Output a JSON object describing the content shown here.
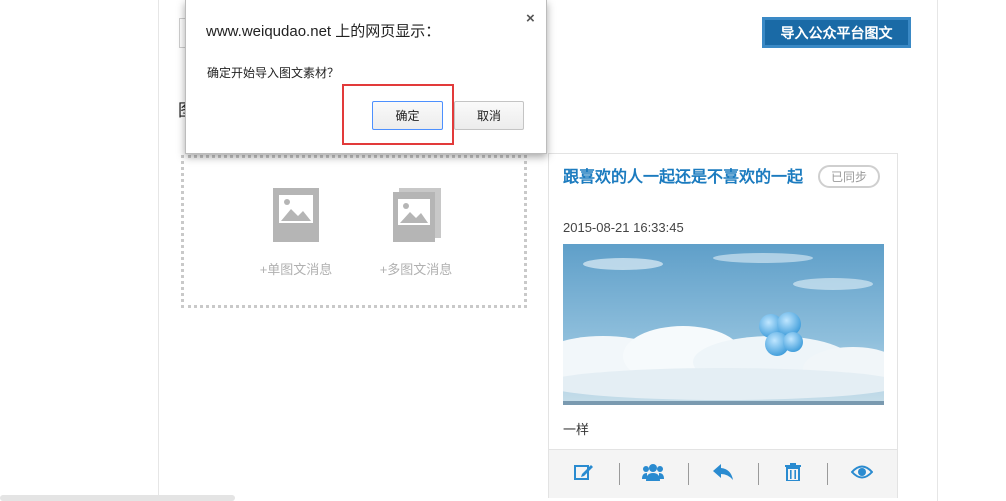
{
  "toolbar": {
    "import_label": "导入公众平台图文"
  },
  "section": {
    "heading_char": "图"
  },
  "create": {
    "single_label": "+单图文消息",
    "multi_label": "+多图文消息"
  },
  "card": {
    "title": "跟喜欢的人一起还是不喜欢的一起",
    "sync_badge": "已同步",
    "date": "2015-08-21 16:33:45",
    "description": "一样",
    "actions": [
      "edit-icon",
      "group-icon",
      "reply-icon",
      "trash-icon",
      "eye-icon"
    ]
  },
  "dialog": {
    "title": "www.weiqudao.net 上的网页显示：",
    "close": "×",
    "message": "确定开始导入图文素材？",
    "ok_label": "确定",
    "cancel_label": "取消"
  },
  "colors": {
    "accent": "#1b7bbf",
    "import_button": "#1a6aa6",
    "highlight_border": "#e23a3a"
  }
}
